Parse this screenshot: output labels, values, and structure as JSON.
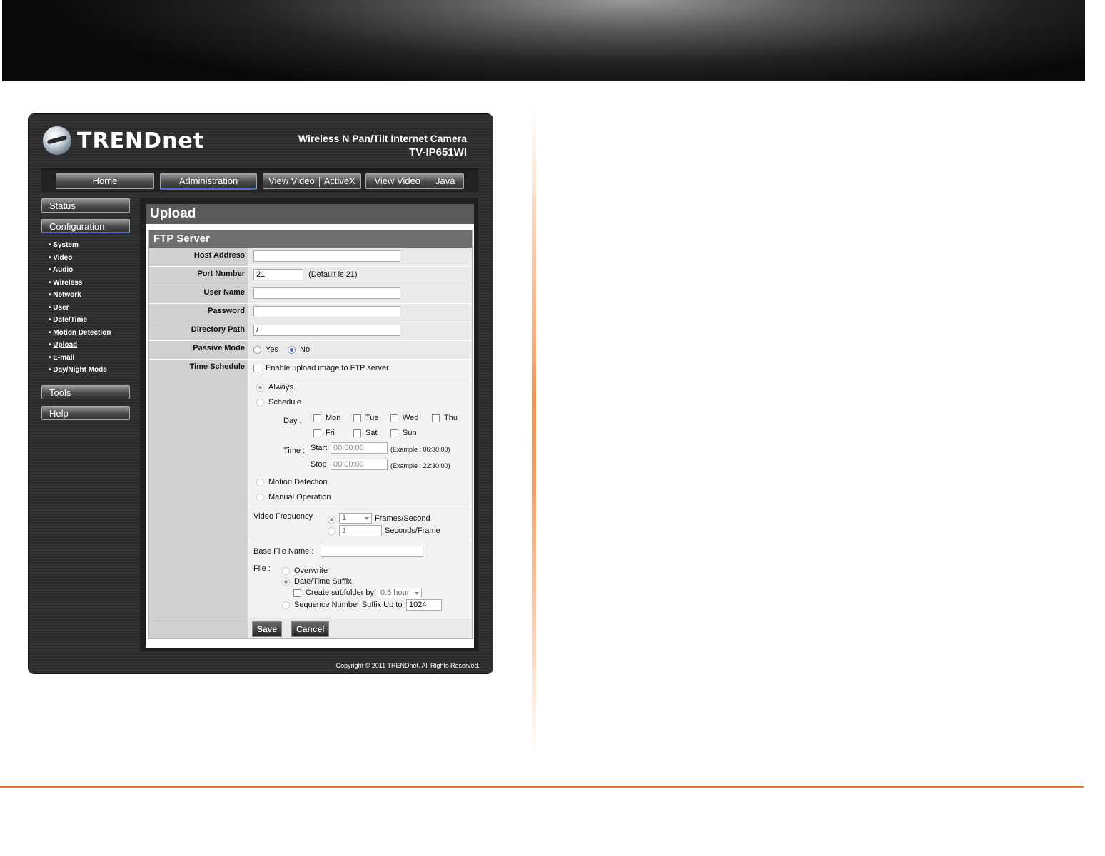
{
  "brand": {
    "logo_text": "TRENDnet",
    "product_line": "Wireless N Pan/Tilt Internet Camera",
    "model": "TV-IP651WI"
  },
  "topnav": {
    "home": "Home",
    "administration": "Administration",
    "view_video_activex_a": "View Video",
    "view_video_activex_b": "ActiveX",
    "view_video_java_a": "View Video",
    "view_video_java_b": "Java"
  },
  "sidebar": {
    "status": "Status",
    "configuration": "Configuration",
    "items": [
      "System",
      "Video",
      "Audio",
      "Wireless",
      "Network",
      "User",
      "Date/Time",
      "Motion Detection",
      "Upload",
      "E-mail",
      "Day/Night Mode"
    ],
    "tools": "Tools",
    "help": "Help"
  },
  "page": {
    "title": "Upload",
    "section": "FTP Server"
  },
  "form": {
    "host_address": {
      "label": "Host Address",
      "value": ""
    },
    "port_number": {
      "label": "Port Number",
      "value": "21",
      "hint": "(Default is 21)"
    },
    "user_name": {
      "label": "User Name",
      "value": ""
    },
    "password": {
      "label": "Password",
      "value": ""
    },
    "directory_path": {
      "label": "Directory Path",
      "value": "/"
    },
    "passive_mode": {
      "label": "Passive Mode",
      "yes": "Yes",
      "no": "No",
      "selected": "No"
    },
    "time_schedule": {
      "label": "Time Schedule",
      "enable_label": "Enable upload image to FTP server",
      "always": "Always",
      "schedule": "Schedule",
      "day_label": "Day :",
      "days": [
        "Mon",
        "Tue",
        "Wed",
        "Thu",
        "Fri",
        "Sat",
        "Sun"
      ],
      "time_label": "Time :",
      "start_label": "Start",
      "start_value": "00:00:00",
      "start_example": "(Example : 06:30:00)",
      "stop_label": "Stop",
      "stop_value": "00:00:00",
      "stop_example": "(Example : 22:30:00)",
      "motion_detection": "Motion Detection",
      "manual_operation": "Manual Operation"
    },
    "video_frequency": {
      "label": "Video Frequency :",
      "fps_value": "1",
      "fps_unit": "Frames/Second",
      "spf_value": "1",
      "spf_unit": "Seconds/Frame"
    },
    "base_file_name": {
      "label": "Base File Name :",
      "value": ""
    },
    "file": {
      "label": "File :",
      "overwrite": "Overwrite",
      "datetime_suffix": "Date/Time Suffix",
      "create_subfolder": "Create subfolder by",
      "subfolder_value": "0.5 hour",
      "sequence_suffix": "Sequence Number Suffix Up to",
      "sequence_value": "1024"
    },
    "save": "Save",
    "cancel": "Cancel"
  },
  "footer": {
    "copyright": "Copyright © 2011 TRENDnet. All Rights Reserved."
  },
  "colors": {
    "accent_orange": "#e8752a",
    "nav_active_underline": "#4a6fd0"
  }
}
